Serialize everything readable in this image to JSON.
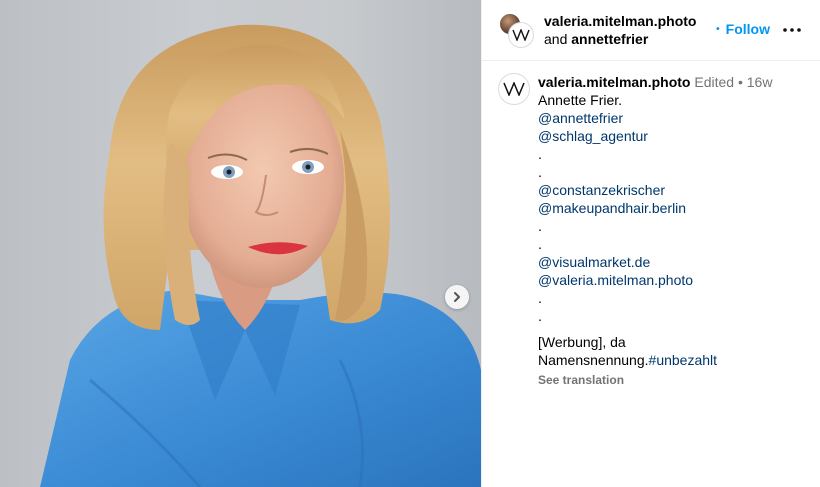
{
  "header": {
    "username": "valeria.mitelman.photo",
    "and_text": "and",
    "collaborator": "annettefrier",
    "follow_label": "Follow",
    "dot": "•"
  },
  "caption": {
    "username": "valeria.mitelman.photo",
    "edited": "Edited",
    "separator": "•",
    "time": "16w",
    "lines": [
      {
        "text": "Annette Frier.",
        "type": "text"
      },
      {
        "text": "@annettefrier",
        "type": "mention"
      },
      {
        "text": "@schlag_agentur",
        "type": "mention"
      },
      {
        "text": ".",
        "type": "text"
      },
      {
        "text": ".",
        "type": "text"
      },
      {
        "text": "@constanzekrischer",
        "type": "mention"
      },
      {
        "text": "@makeupandhair.berlin",
        "type": "mention"
      },
      {
        "text": ".",
        "type": "text"
      },
      {
        "text": ".",
        "type": "text"
      },
      {
        "text": "@visualmarket.de",
        "type": "mention"
      },
      {
        "text": "@valeria.mitelman.photo",
        "type": "mention"
      },
      {
        "text": ".",
        "type": "text"
      },
      {
        "text": ".",
        "type": "text"
      }
    ],
    "werbung_line1": "[Werbung], da",
    "werbung_line2_text": "Namensnennung.",
    "werbung_line2_tag": "#unbezahlt",
    "see_translation": "See translation"
  },
  "media": {
    "next_icon": "chevron-right-icon"
  },
  "colors": {
    "link": "#00376b",
    "follow": "#0095f6",
    "meta": "#737373",
    "shirt": "#3f8fd6",
    "hair": "#d7ad72"
  }
}
